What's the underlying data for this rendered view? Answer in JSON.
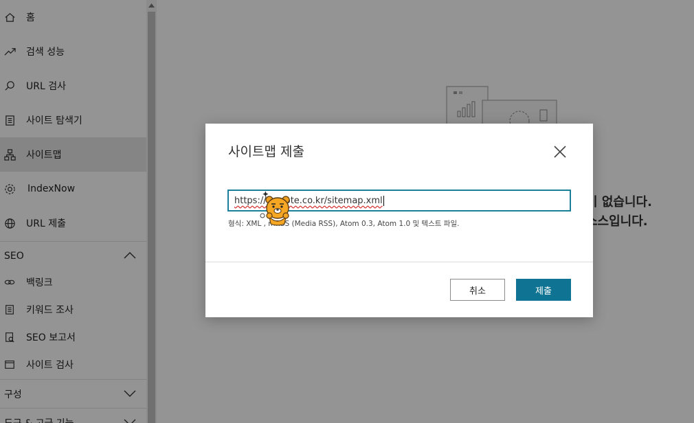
{
  "sidebar": {
    "items": [
      {
        "label": "홈",
        "icon": "home-icon"
      },
      {
        "label": "검색 성능",
        "icon": "trend-icon"
      },
      {
        "label": "URL 검사",
        "icon": "search-icon"
      },
      {
        "label": "사이트 탐색기",
        "icon": "document-icon"
      },
      {
        "label": "사이트맵",
        "icon": "sitemap-icon",
        "active": true
      },
      {
        "label": "IndexNow",
        "icon": "gear-icon"
      },
      {
        "label": "URL 제출",
        "icon": "globe-icon"
      }
    ],
    "seo": {
      "label": "SEO",
      "items": [
        {
          "label": "백링크",
          "icon": "link-icon"
        },
        {
          "label": "키워드 조사",
          "icon": "list-icon"
        },
        {
          "label": "SEO 보고서",
          "icon": "report-icon"
        },
        {
          "label": "사이트 검사",
          "icon": "browser-icon"
        }
      ]
    },
    "config": {
      "label": "구성"
    },
    "tools": {
      "label": "도구 & 고급 기능"
    }
  },
  "main": {
    "empty_line1": "이 없습니다.",
    "empty_line2": "소스입니다."
  },
  "dialog": {
    "title": "사이트맵 제출",
    "input_value": "https://      esnote.co.kr/sitemap.xml",
    "hint": "형식: XML          , mRSS (Media RSS), Atom 0.3, Atom 1.0 및 텍스트 파일.",
    "cancel_label": "취소",
    "submit_label": "제출"
  },
  "colors": {
    "accent": "#0f7393",
    "input_border": "#1a7f9a",
    "overlay": "rgba(0,0,0,0.42)"
  }
}
